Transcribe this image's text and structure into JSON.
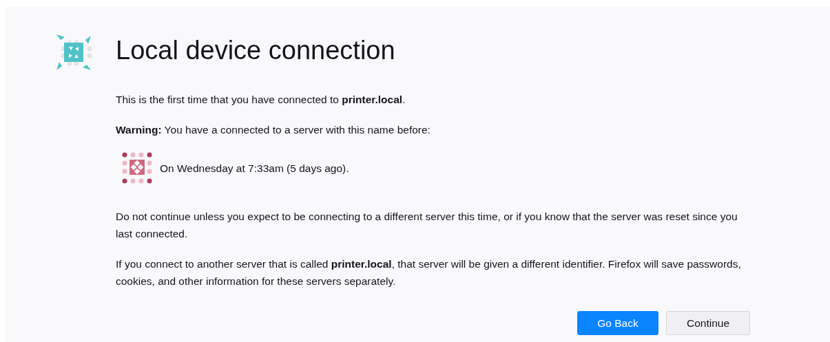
{
  "title": "Local device connection",
  "intro": "This is the first time that you have connected to **printer.local**.",
  "warning": "**Warning:** You have a connected to a server with this name before:",
  "history": [
    {
      "text": "On Wednesday at 7:33am (5 days ago)."
    }
  ],
  "paragraphs": [
    "Do not continue unless you expect to be connecting to a different server this time, or if you know that the server was reset since you last connected.",
    "If you connect to another server that is called **printer.local**, that server will be given a different identifier. Firefox will save passwords, cookies, and other information for these servers separately."
  ],
  "buttons": [
    {
      "label": "Go Back",
      "primary": true
    },
    {
      "label": "Continue",
      "primary": false
    }
  ]
}
